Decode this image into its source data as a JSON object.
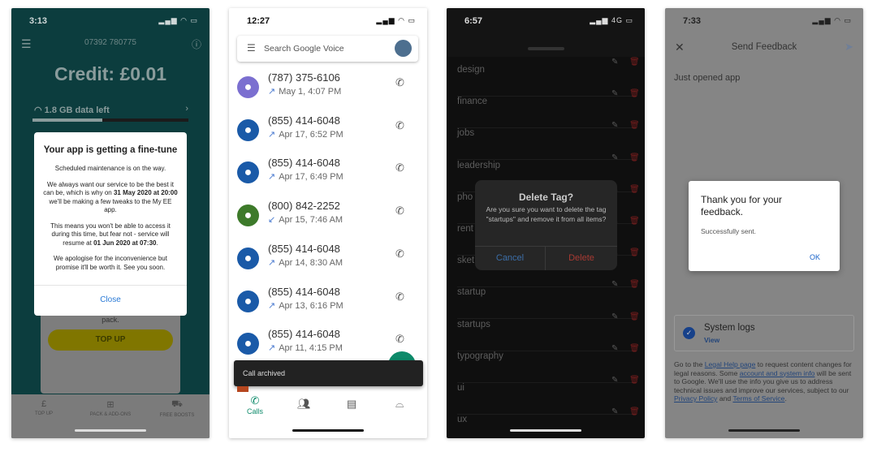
{
  "phone1": {
    "status_time": "3:13",
    "phone_number": "07392 780775",
    "credit": "Credit: £0.01",
    "data_left": "1.8 GB data left",
    "data_fraction": 0.45,
    "dialog": {
      "title": "Your app is getting a fine-tune",
      "p1": "Scheduled maintenance is on the way.",
      "p2a": "We always want our service to be the best it can be, which is why on ",
      "p2b": "31 May 2020 at 20:00",
      "p2c": " we'll be making a few tweaks to the My EE app.",
      "p3a": "This means you won't be able to access it during this time, but fear not - service will resume at ",
      "p3b": "01 Jun 2020 at 07:30",
      "p3c": ".",
      "p4": "We apologise for the inconvenience but promise it'll be worth it. See you soon.",
      "close": "Close"
    },
    "card_text": "pack.",
    "top_up_button": "TOP UP",
    "nav": [
      {
        "icon": "£",
        "label": "TOP UP"
      },
      {
        "icon": "⊞",
        "label": "PACK & ADD-ONS"
      },
      {
        "icon": "⛟",
        "label": "FREE BOOSTS"
      }
    ]
  },
  "phone2": {
    "status_time": "12:27",
    "search_placeholder": "Search Google Voice",
    "calls": [
      {
        "number": "(787) 375-6106",
        "date": "May 1, 4:07 PM",
        "dir": "↗",
        "color": "#7b6fd0"
      },
      {
        "number": "(855) 414-6048",
        "date": "Apr 17, 6:52 PM",
        "dir": "↗",
        "color": "#1a5aa8"
      },
      {
        "number": "(855) 414-6048",
        "date": "Apr 17, 6:49 PM",
        "dir": "↗",
        "color": "#1a5aa8"
      },
      {
        "number": "(800) 842-2252",
        "date": "Apr 15, 7:46 AM",
        "dir": "↙",
        "color": "#3d7a2a"
      },
      {
        "number": "(855) 414-6048",
        "date": "Apr 14, 8:30 AM",
        "dir": "↗",
        "color": "#1a5aa8"
      },
      {
        "number": "(855) 414-6048",
        "date": "Apr 13, 6:16 PM",
        "dir": "↗",
        "color": "#1a5aa8"
      },
      {
        "number": "(855) 414-6048",
        "date": "Apr 11, 4:15 PM",
        "dir": "↗",
        "color": "#1a5aa8"
      }
    ],
    "snackbar": "Call archived",
    "nav_calls": "Calls"
  },
  "phone3": {
    "status_time": "6:57",
    "network": "4G",
    "tags": [
      "design",
      "finance",
      "jobs",
      "leadership",
      "pho",
      "rent",
      "sket",
      "startup",
      "startups",
      "typography",
      "ui",
      "ux"
    ],
    "dialog": {
      "title": "Delete Tag?",
      "message": "Are you sure you want to delete the tag \"startups\" and remove it from all items?",
      "cancel": "Cancel",
      "delete": "Delete"
    }
  },
  "phone4": {
    "status_time": "7:33",
    "title": "Send Feedback",
    "feedback_text": "Just opened app",
    "dialog": {
      "title": "Thank you for your feedback.",
      "message": "Successfully sent.",
      "ok": "OK"
    },
    "system_logs": "System logs",
    "view": "View",
    "legal": {
      "t1": "Go to the ",
      "l1": "Legal Help page",
      "t2": " to request content changes for legal reasons. Some ",
      "l2": "account and system info",
      "t3": " will be sent to Google. We'll use the info you give us to address technical issues and improve our services, subject to our ",
      "l3": "Privacy Policy",
      "t4": " and ",
      "l4": "Terms of Service",
      "t5": "."
    }
  }
}
